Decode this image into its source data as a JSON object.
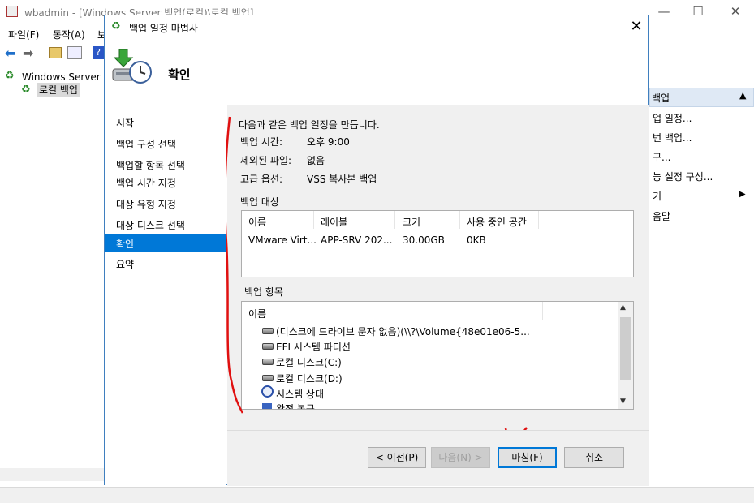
{
  "window": {
    "title": "wbadmin - [Windows Server 백업(로컬)\\로컬 백업]",
    "minimize": "—",
    "maximize": "☐",
    "close": "✕"
  },
  "menu": {
    "file": "파일(F)",
    "action": "동작(A)",
    "view_partial": "보"
  },
  "tree": {
    "root_label": "Windows Server 백",
    "child_label": "로컬 백업"
  },
  "actions_pane": {
    "header": "백업",
    "items": [
      "업 일정...",
      "번 백업...",
      "구...",
      "능 설정 구성...",
      "기",
      "움말"
    ]
  },
  "dialog": {
    "title": "백업 일정 마법사",
    "close": "✕",
    "header_title": "확인",
    "nav": [
      "시작",
      "백업 구성 선택",
      "백업할 항목 선택",
      "백업 시간 지정",
      "대상 유형 지정",
      "대상 디스크 선택",
      "확인",
      "요약"
    ],
    "intro": "다음과 같은 백업 일정을 만듭니다.",
    "summary": [
      {
        "label": "백업 시간:",
        "value": "오후 9:00"
      },
      {
        "label": "제외된 파일:",
        "value": "없음"
      },
      {
        "label": "고급 옵션:",
        "value": "VSS 복사본 백업"
      }
    ],
    "target_section": "백업 대상",
    "target_columns": [
      "이름",
      "레이블",
      "크기",
      "사용 중인 공간"
    ],
    "target_row": [
      "VMware Virt...",
      "APP-SRV 202...",
      "30.00GB",
      "0KB"
    ],
    "items_section": "백업 항목",
    "items_column": "이름",
    "items": [
      "(디스크에 드라이브 문자 없음)(\\\\?\\Volume{48e01e06-5...",
      "EFI 시스템 파티션",
      "로컬 디스크(C:)",
      "로컬 디스크(D:)",
      "시스템 상태",
      "완전 복구"
    ],
    "buttons": {
      "prev": "< 이전(P)",
      "next": "다음(N) >",
      "finish": "마침(F)",
      "cancel": "취소"
    }
  }
}
